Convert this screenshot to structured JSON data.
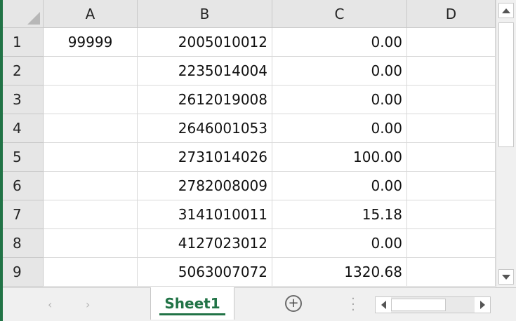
{
  "columns": [
    "A",
    "B",
    "C",
    "D"
  ],
  "rows": [
    {
      "num": "1",
      "a": "99999",
      "b": "2005010012",
      "c": "0.00",
      "d": ""
    },
    {
      "num": "2",
      "a": "",
      "b": "2235014004",
      "c": "0.00",
      "d": ""
    },
    {
      "num": "3",
      "a": "",
      "b": "2612019008",
      "c": "0.00",
      "d": ""
    },
    {
      "num": "4",
      "a": "",
      "b": "2646001053",
      "c": "0.00",
      "d": ""
    },
    {
      "num": "5",
      "a": "",
      "b": "2731014026",
      "c": "100.00",
      "d": ""
    },
    {
      "num": "6",
      "a": "",
      "b": "2782008009",
      "c": "0.00",
      "d": ""
    },
    {
      "num": "7",
      "a": "",
      "b": "3141010011",
      "c": "15.18",
      "d": ""
    },
    {
      "num": "8",
      "a": "",
      "b": "4127023012",
      "c": "0.00",
      "d": ""
    },
    {
      "num": "9",
      "a": "",
      "b": "5063007072",
      "c": "1320.68",
      "d": ""
    }
  ],
  "sheet_tabs": [
    {
      "label": "Sheet1",
      "active": true
    }
  ],
  "icons": {
    "add_sheet": "plus-circle-icon",
    "nav_prev": "chevron-left-icon",
    "nav_next": "chevron-right-icon"
  },
  "colors": {
    "accent": "#217346",
    "header_bg": "#e6e6e6",
    "gridline": "#d9d9d9"
  }
}
